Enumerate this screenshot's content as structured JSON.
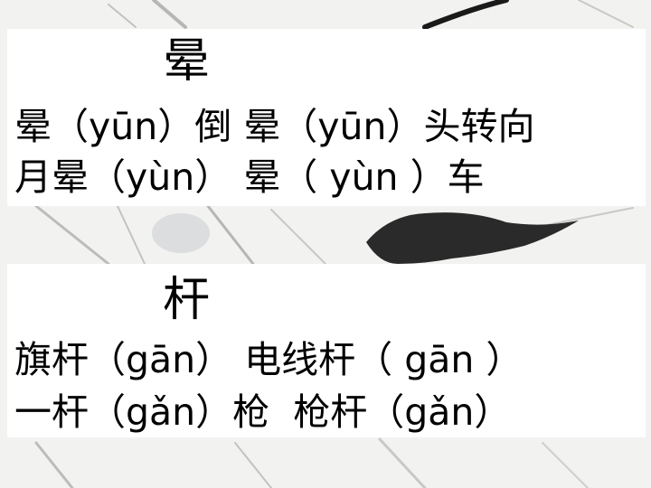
{
  "slide": {
    "background_color": "#f2f2f0",
    "section_yun": {
      "heading": "晕",
      "line1": "晕（yūn）倒 晕（yūn）头转向",
      "line2": "月晕（yùn） 晕（ yùn ）车"
    },
    "section_gan": {
      "heading": "杆",
      "line1": "旗杆（gān） 电线杆（ gān ）",
      "line2": "一杆（gǎn）枪  枪杆（gǎn）"
    }
  }
}
